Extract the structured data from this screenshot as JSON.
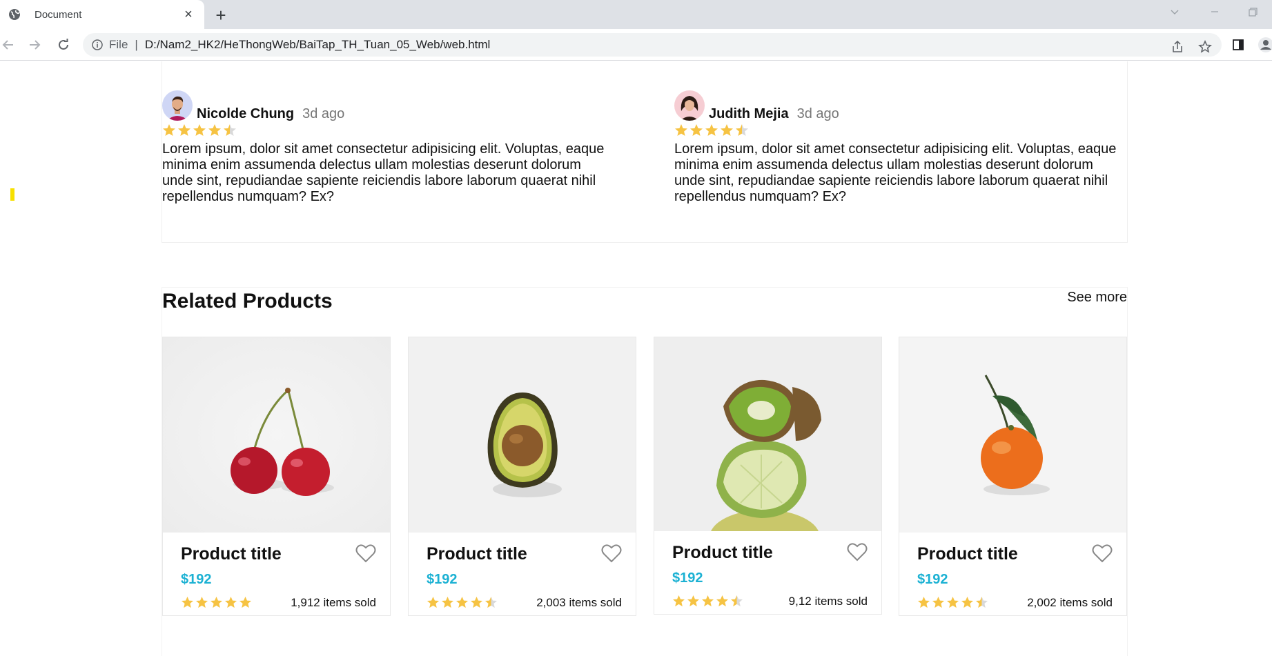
{
  "browser": {
    "tab_title": "Document",
    "tab_close": "×",
    "new_tab": "+",
    "file_label": "File",
    "separator": "|",
    "url": "D:/Nam2_HK2/HeThongWeb/BaiTap_TH_Tuan_05_Web/web.html"
  },
  "reviews": [
    {
      "name": "Nicolde Chung",
      "ago": "3d ago",
      "rating": 4.5,
      "text": "Lorem ipsum, dolor sit amet consectetur adipisicing elit. Voluptas, eaque minima enim assumenda delectus ullam molestias deserunt dolorum unde sint, repudiandae sapiente reiciendis labore laborum quaerat nihil repellendus numquam? Ex?"
    },
    {
      "name": "Judith Mejia",
      "ago": "3d ago",
      "rating": 4.5,
      "text": "Lorem ipsum, dolor sit amet consectetur adipisicing elit. Voluptas, eaque minima enim assumenda delectus ullam molestias deserunt dolorum unde sint, repudiandae sapiente reiciendis labore laborum quaerat nihil repellendus numquam? Ex?"
    }
  ],
  "related": {
    "title": "Related Products",
    "see_more": "See more",
    "products": [
      {
        "title": "Product title",
        "price": "$192",
        "rating": 5,
        "sold": "1,912 items sold",
        "image": "cherry"
      },
      {
        "title": "Product title",
        "price": "$192",
        "rating": 4.5,
        "sold": "2,003 items sold",
        "image": "avocado"
      },
      {
        "title": "Product title",
        "price": "$192",
        "rating": 4.5,
        "sold": "9,12 items sold",
        "image": "kiwi-lime"
      },
      {
        "title": "Product title",
        "price": "$192",
        "rating": 4.5,
        "sold": "2,002 items sold",
        "image": "tangerine"
      }
    ]
  },
  "colors": {
    "star": "#f6c343",
    "star_empty": "#d9d9d9",
    "price": "#1bb1d3",
    "highlight_mark": "#f7e000"
  }
}
